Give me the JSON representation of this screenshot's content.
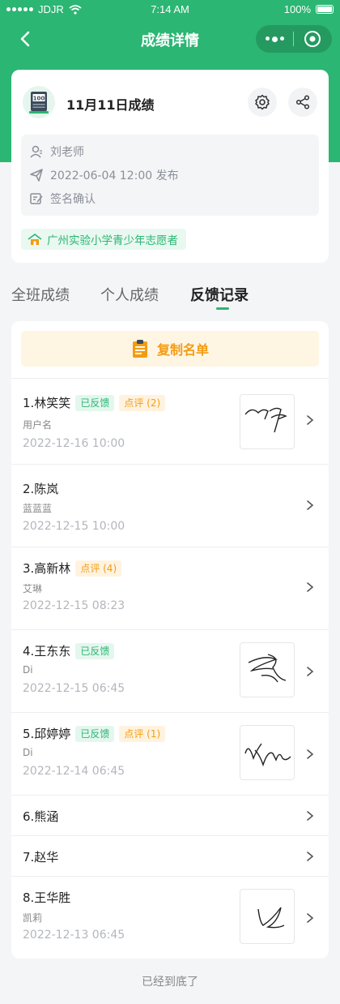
{
  "status_bar": {
    "carrier": "JDJR",
    "time": "7:14 AM",
    "battery": "100%"
  },
  "nav": {
    "title": "成绩详情"
  },
  "header_card": {
    "title": "11月11日成绩",
    "icon_text": "100",
    "teacher": "刘老师",
    "publish": "2022-06-04 12:00 发布",
    "sign": "签名确认",
    "org": "广州实验小学青少年志愿者"
  },
  "tabs": [
    {
      "label": "全班成绩"
    },
    {
      "label": "个人成绩"
    },
    {
      "label": "反馈记录"
    }
  ],
  "copy_button": {
    "label": "复制名单"
  },
  "records": [
    {
      "name": "1.林笑笑",
      "feedback": "已反馈",
      "comment": "点评 (2)",
      "sub": "用户名",
      "date": "2022-12-16 10:00"
    },
    {
      "name": "2.陈岚",
      "sub": "蓝蓝蓝",
      "date": "2022-12-15 10:00"
    },
    {
      "name": "3.高新林",
      "comment": "点评 (4)",
      "sub": "艾琳",
      "date": "2022-12-15 08:23"
    },
    {
      "name": "4.王东东",
      "feedback": "已反馈",
      "sub": "Di",
      "date": "2022-12-15 06:45"
    },
    {
      "name": "5.邱婷婷",
      "feedback": "已反馈",
      "comment": "点评 (1)",
      "sub": "Di",
      "date": "2022-12-14 06:45"
    },
    {
      "name": "6.熊涵"
    },
    {
      "name": "7.赵华"
    },
    {
      "name": "8.王华胜",
      "sub": "凯莉",
      "date": "2022-12-13 06:45"
    }
  ],
  "footer": "已经到底了",
  "colors": {
    "brand": "#2bb673",
    "orange": "#f39c12"
  },
  "icons": [
    "back-icon",
    "more-dots-icon",
    "target-icon",
    "score-board-icon",
    "gear-icon",
    "share-icon",
    "user-icon",
    "send-icon",
    "sign-icon",
    "school-icon",
    "clipboard-icon",
    "chevron-right-icon",
    "signature-image"
  ]
}
